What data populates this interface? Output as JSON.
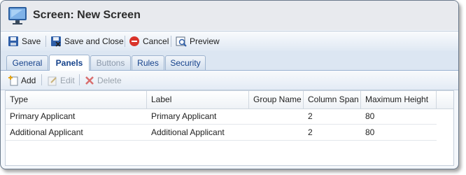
{
  "window": {
    "title": "Screen: New Screen"
  },
  "toolbar": {
    "save": "Save",
    "save_close": "Save and Close",
    "cancel": "Cancel",
    "preview": "Preview"
  },
  "tabs": [
    {
      "label": "General"
    },
    {
      "label": "Panels"
    },
    {
      "label": "Buttons"
    },
    {
      "label": "Rules"
    },
    {
      "label": "Security"
    }
  ],
  "subtoolbar": {
    "add": "Add",
    "edit": "Edit",
    "delete": "Delete"
  },
  "grid": {
    "columns": [
      "Type",
      "Label",
      "Group Name",
      "Column Span",
      "Maximum Height"
    ],
    "rows": [
      [
        "Primary Applicant",
        "Primary Applicant",
        "",
        "2",
        "80"
      ],
      [
        "Additional Applicant",
        "Additional Applicant",
        "",
        "2",
        "80"
      ]
    ]
  },
  "colors": {
    "accent": "#15428b",
    "cancel_red": "#d9342b"
  }
}
